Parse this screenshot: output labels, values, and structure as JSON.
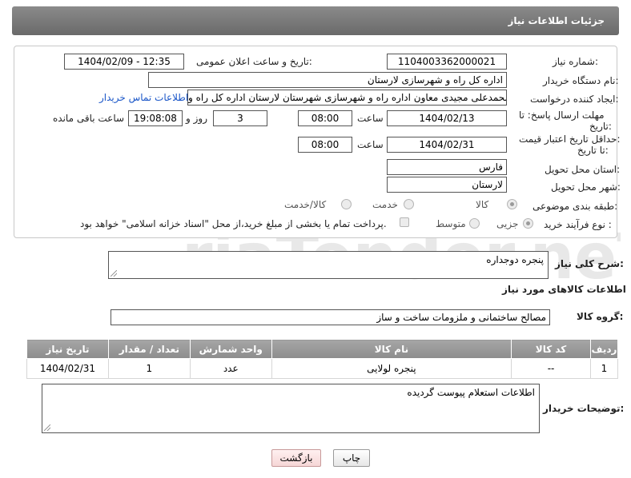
{
  "header": {
    "title": "جزئیات اطلاعات نیاز"
  },
  "form": {
    "need_number_label": "شماره نیاز:",
    "need_number": "1104003362000021",
    "announce_label": "تاریخ و ساعت اعلان عمومی:",
    "announce_value": "1404/02/09 - 12:35",
    "buyer_org_label": "نام دستگاه خریدار:",
    "buyer_org": "اداره کل راه و شهرسازی لارستان",
    "creator_label": "ایجاد کننده درخواست:",
    "creator": "محمدعلی مجیدی معاون اداره راه و شهرسازی شهرستان لارستان اداره کل راه و",
    "contact_link": "اطلاعات تماس خریدار",
    "deadline_label_1": "مهلت ارسال پاسخ: تا",
    "deadline_label_2": "تاریخ:",
    "deadline_date": "1404/02/13",
    "time_label": "ساعت",
    "deadline_time": "08:00",
    "days": "3",
    "days_label": "روز و",
    "remaining_time": "19:08:08",
    "remaining_label": "ساعت باقی مانده",
    "validity_label_1": "حداقل تاریخ اعتبار قیمت:",
    "validity_label_2": "تا تاریخ:",
    "validity_date": "1404/02/31",
    "validity_time_label": "ساعت",
    "validity_time": "08:00",
    "province_label": "استان محل تحویل:",
    "province": "فارس",
    "city_label": "شهر محل تحویل:",
    "city": "لارستان",
    "category_label": "طبقه بندی موضوعی:",
    "category_options": [
      "کالا",
      "خدمت",
      "کالا/خدمت"
    ],
    "category_selected": "کالا",
    "process_label": "نوع فرآیند خرید :",
    "process_options": [
      "جزیی",
      "متوسط"
    ],
    "process_selected": "جزیی",
    "payment_note": "پرداخت تمام یا بخشی از مبلغ خرید،از محل \"اسناد خزانه اسلامی\" خواهد بود."
  },
  "summary": {
    "label": "شرح کلی نیاز:",
    "value": "پنجره دوجداره"
  },
  "goods": {
    "section_title": "اطلاعات کالاهای مورد نیاز",
    "group_label": "گروه کالا:",
    "group_value": "مصالح ساختمانی و ملزومات ساخت و ساز",
    "columns": [
      "ردیف",
      "کد کالا",
      "نام کالا",
      "واحد شمارش",
      "تعداد / مقدار",
      "تاریخ نیاز"
    ],
    "rows": [
      {
        "row": "1",
        "code": "--",
        "name": "پنجره لولایی",
        "unit": "عدد",
        "qty": "1",
        "date": "1404/02/31"
      }
    ]
  },
  "buyer_notes": {
    "label": "توضیحات خریدار:",
    "value": "اطلاعات استعلام پیوست گردیده"
  },
  "buttons": {
    "print": "چاپ",
    "back": "بازگشت"
  },
  "watermark": {
    "text": "AriaTender.neT"
  }
}
